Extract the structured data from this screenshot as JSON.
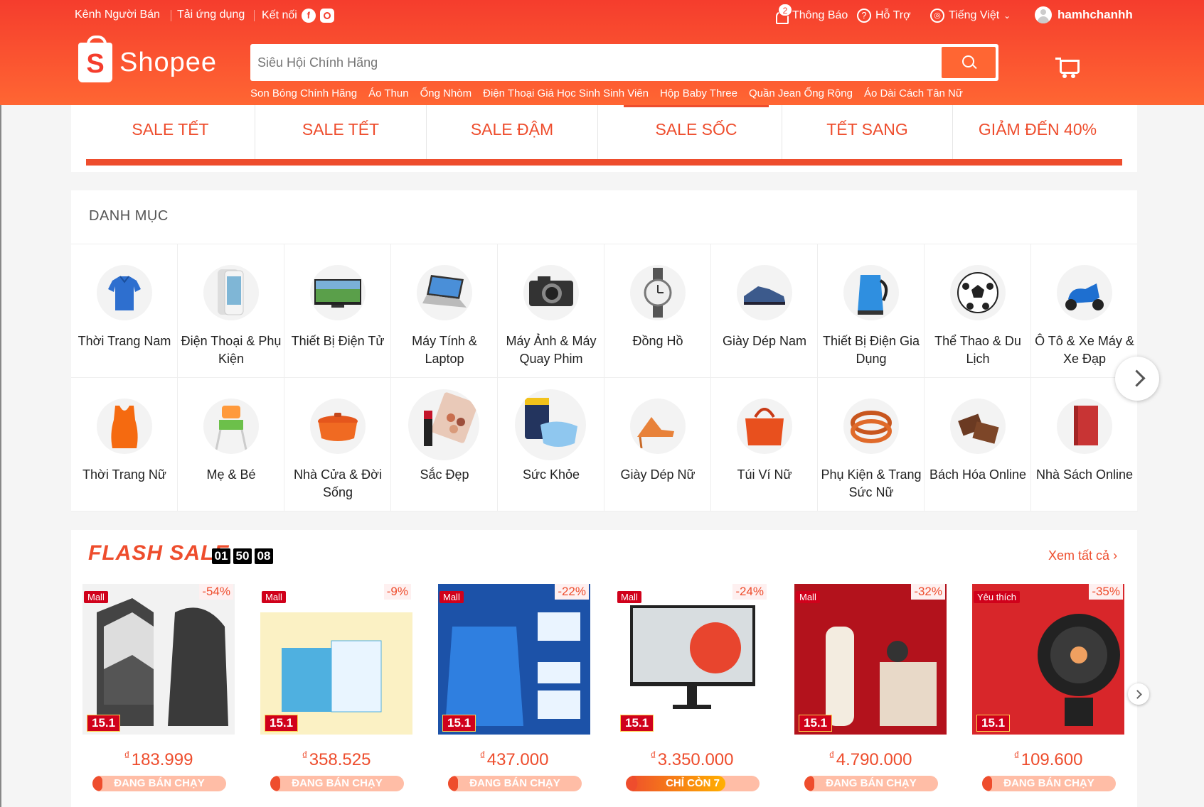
{
  "topbar": {
    "seller": "Kênh Người Bán",
    "app": "Tải ứng dụng",
    "connect": "Kết nối",
    "notifications": "Thông Báo",
    "notif_count": "2",
    "help": "Hỗ Trợ",
    "language": "Tiếng Việt",
    "username": "hamhchanhh"
  },
  "brand": {
    "name": "Shopee",
    "color": "#ee4d2d"
  },
  "search": {
    "placeholder": "Siêu Hội Chính Hãng",
    "suggestions": [
      "Son Bóng Chính Hãng",
      "Áo Thun",
      "Ống Nhòm",
      "Điện Thoại Giá Học Sinh Sinh Viên",
      "Hộp Baby Three",
      "Quần Jean Ống Rộng",
      "Áo Dài Cách Tân Nữ"
    ]
  },
  "sale_tabs": [
    "SALE TẾT",
    "SALE TẾT",
    "SALE ĐẬM",
    "SALE SỐC",
    "TẾT SANG",
    "GIẢM ĐẾN 40%"
  ],
  "categories": {
    "title": "DANH MỤC",
    "items": [
      "Thời Trang Nam",
      "Điện Thoại & Phụ Kiện",
      "Thiết Bị Điện Tử",
      "Máy Tính & Laptop",
      "Máy Ảnh & Máy Quay Phim",
      "Đồng Hồ",
      "Giày Dép Nam",
      "Thiết Bị Điện Gia Dụng",
      "Thể Thao & Du Lịch",
      "Ô Tô & Xe Máy & Xe Đạp",
      "Thời Trang Nữ",
      "Mẹ & Bé",
      "Nhà Cửa & Đời Sống",
      "Sắc Đẹp",
      "Sức Khỏe",
      "Giày Dép Nữ",
      "Túi Ví Nữ",
      "Phụ Kiện & Trang Sức Nữ",
      "Bách Hóa Online",
      "Nhà Sách Online"
    ]
  },
  "flash_sale": {
    "title": "FLASH SALE",
    "timer": [
      "01",
      "50",
      "08"
    ],
    "see_all": "Xem tất cả",
    "products": [
      {
        "badge": "Mall",
        "discount": "-54%",
        "currency": "₫",
        "price": "183.999",
        "status": "ĐANG BÁN CHẠY",
        "tag": "15.1"
      },
      {
        "badge": "Mall",
        "discount": "-9%",
        "currency": "₫",
        "price": "358.525",
        "status": "ĐANG BÁN CHẠY",
        "tag": "15.1"
      },
      {
        "badge": "Mall",
        "discount": "-22%",
        "currency": "₫",
        "price": "437.000",
        "status": "ĐANG BÁN CHẠY",
        "tag": "15.1"
      },
      {
        "badge": "Mall",
        "discount": "-24%",
        "currency": "₫",
        "price": "3.350.000",
        "status": "CHỈ CÒN 7",
        "tag": "15.1"
      },
      {
        "badge": "Mall",
        "discount": "-32%",
        "currency": "₫",
        "price": "4.790.000",
        "status": "ĐANG BÁN CHẠY",
        "tag": "15.1"
      },
      {
        "badge": "Yêu thích",
        "discount": "-35%",
        "currency": "₫",
        "price": "109.600",
        "status": "ĐANG BÁN CHẠY",
        "tag": "15.1"
      }
    ]
  }
}
